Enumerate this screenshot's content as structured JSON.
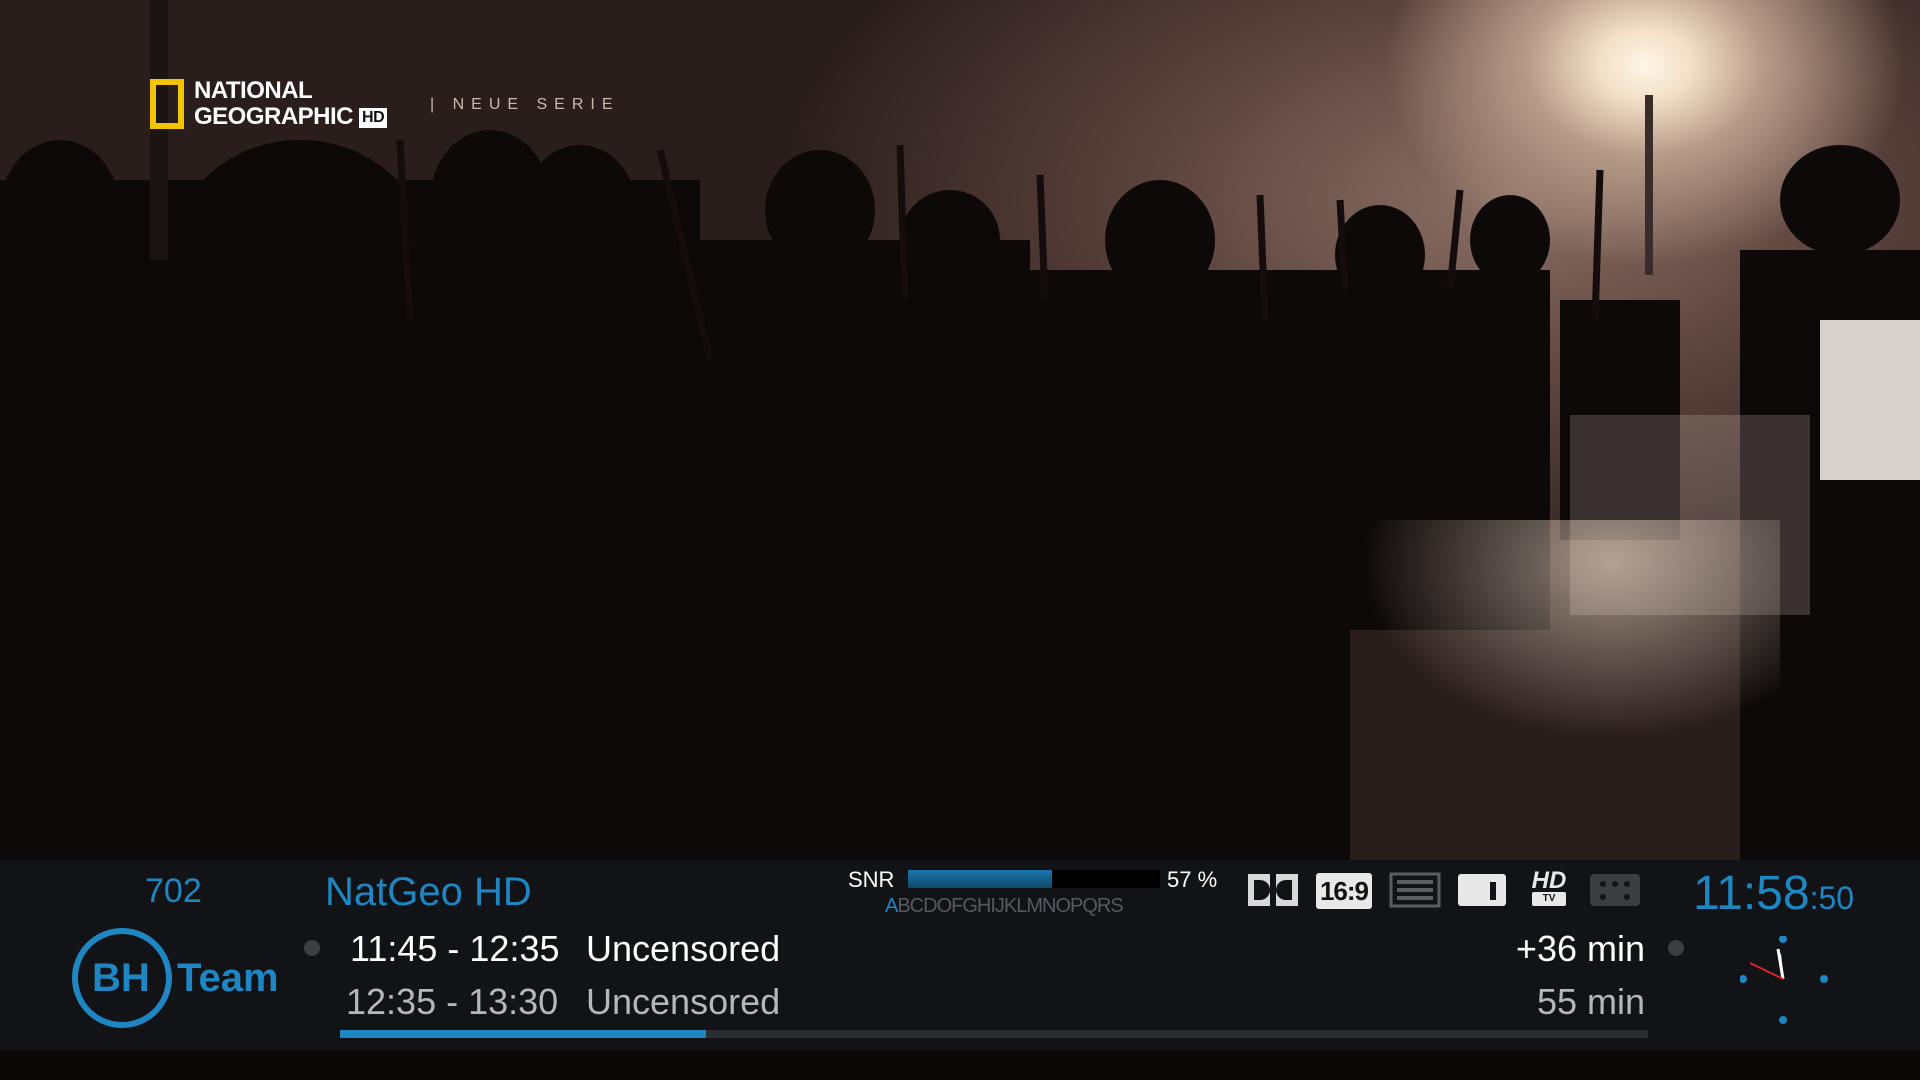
{
  "video": {
    "channel_logo": {
      "line1": "NATIONAL",
      "line2": "GEOGRAPHIC",
      "badge": "HD"
    },
    "overlay_text": "|  NEUE SERIE"
  },
  "infobar": {
    "channel_number": "702",
    "channel_name": "NatGeo HD",
    "provider_logo": {
      "part1": "BH",
      "part2": "Team"
    },
    "now": {
      "time": "11:45 - 12:35",
      "title": "Uncensored",
      "remaining": "+36 min"
    },
    "next": {
      "time": "12:35 - 13:30",
      "title": "Uncensored",
      "duration": "55 min"
    },
    "progress": 0.28,
    "snr": {
      "label": "SNR",
      "value_text": "57 %",
      "value": 57
    },
    "caids": {
      "highlight": "A",
      "rest": "BCDOFGHIJKLMNOPQRS"
    },
    "icons": [
      "dolby-icon",
      "aspect-16-9-icon",
      "teletext-icon",
      "subtitle-icon",
      "hd-tv-icon",
      "crypt-icon"
    ],
    "aspect_label": "16:9",
    "hd_label": "HD",
    "hd_sub": "TV",
    "clock": {
      "hm": "11:58",
      "sec": ":50"
    }
  },
  "colors": {
    "accent": "#1e86c2",
    "osd_bg": "#111316"
  }
}
